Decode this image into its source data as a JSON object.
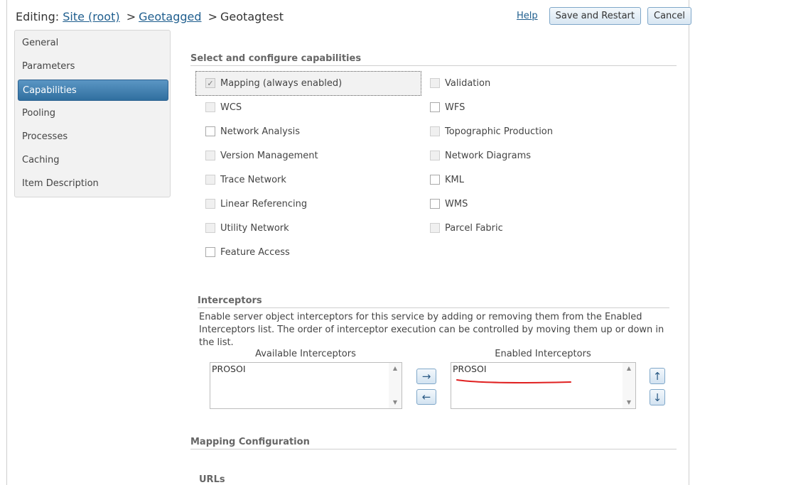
{
  "header": {
    "prefix": "Editing:",
    "crumbs": [
      "Site (root)",
      "Geotagged"
    ],
    "current": "Geotagtest",
    "separator": ">"
  },
  "actions": {
    "help": "Help",
    "save": "Save and Restart",
    "cancel": "Cancel"
  },
  "sidebar": {
    "items": [
      {
        "label": "General"
      },
      {
        "label": "Parameters"
      },
      {
        "label": "Capabilities",
        "active": true
      },
      {
        "label": "Pooling"
      },
      {
        "label": "Processes"
      },
      {
        "label": "Caching"
      },
      {
        "label": "Item Description"
      }
    ]
  },
  "capabilities": {
    "title": "Select and configure capabilities",
    "left": [
      {
        "label": "Mapping (always enabled)",
        "state": "checked-disabled"
      },
      {
        "label": "WCS",
        "state": "disabled"
      },
      {
        "label": "Network Analysis",
        "state": "enabled"
      },
      {
        "label": "Version Management",
        "state": "disabled"
      },
      {
        "label": "Trace Network",
        "state": "disabled"
      },
      {
        "label": "Linear Referencing",
        "state": "disabled"
      },
      {
        "label": "Utility Network",
        "state": "disabled"
      },
      {
        "label": "Feature Access",
        "state": "enabled"
      }
    ],
    "right": [
      {
        "label": "Validation",
        "state": "disabled"
      },
      {
        "label": "WFS",
        "state": "enabled"
      },
      {
        "label": "Topographic Production",
        "state": "disabled"
      },
      {
        "label": "Network Diagrams",
        "state": "disabled"
      },
      {
        "label": "KML",
        "state": "enabled"
      },
      {
        "label": "WMS",
        "state": "enabled"
      },
      {
        "label": "Parcel Fabric",
        "state": "disabled"
      }
    ]
  },
  "interceptors": {
    "title": "Interceptors",
    "description": "Enable server object interceptors for this service by adding or removing them from the Enabled Interceptors list. The order of interceptor execution can be controlled by moving them up or down in the list.",
    "available_label": "Available Interceptors",
    "enabled_label": "Enabled Interceptors",
    "available": [
      "PROSOI"
    ],
    "enabled": [
      "PROSOI"
    ],
    "add_arrow": "→",
    "remove_arrow": "←",
    "up_arrow": "↑",
    "down_arrow": "↓",
    "scroll_up": "▲",
    "scroll_down": "▼"
  },
  "mapping_config": {
    "title": "Mapping Configuration",
    "urls_title": "URLs"
  },
  "colors": {
    "accent": "#306f9f",
    "link": "#1f5e8e",
    "annotation": "#e02020"
  }
}
